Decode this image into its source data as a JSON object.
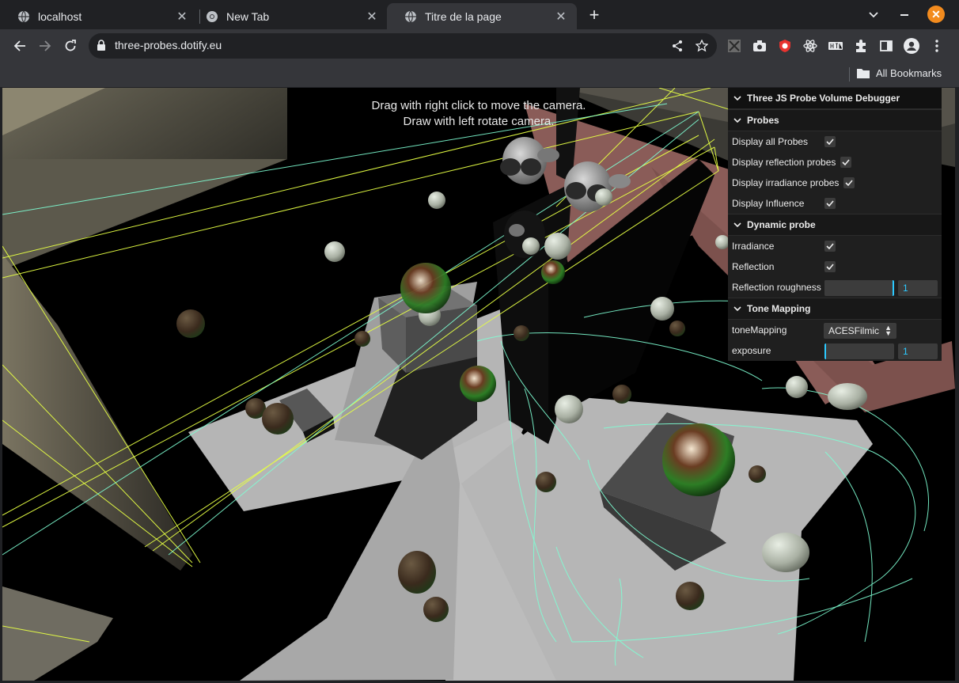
{
  "tabs": [
    {
      "title": "localhost",
      "icon": "globe-icon"
    },
    {
      "title": "New Tab",
      "icon": "chrome-icon"
    },
    {
      "title": "Titre de la page",
      "icon": "globe-icon"
    }
  ],
  "omnibox": {
    "url": "three-probes.dotify.eu"
  },
  "bookmarks": {
    "all_label": "All Bookmarks"
  },
  "scene": {
    "hint_line1": "Drag with right click to move the camera.",
    "hint_line2": "Draw with left rotate camera."
  },
  "gui": {
    "title": "Three JS Probe Volume Debugger",
    "probes": {
      "title": "Probes",
      "display_all": {
        "label": "Display all Probes",
        "checked": true
      },
      "display_reflection": {
        "label": "Display reflection probes",
        "checked": true
      },
      "display_irradiance": {
        "label": "Display irradiance probes",
        "checked": true
      },
      "display_influence": {
        "label": "Display Influence",
        "checked": true
      }
    },
    "dynamic": {
      "title": "Dynamic probe",
      "irradiance": {
        "label": "Irradiance",
        "checked": true
      },
      "reflection": {
        "label": "Reflection",
        "checked": true
      },
      "roughness": {
        "label": "Reflection roughness",
        "value": "1",
        "fraction": 1.0
      }
    },
    "tone": {
      "title": "Tone Mapping",
      "mapping": {
        "label": "toneMapping",
        "value": "ACESFilmic"
      },
      "exposure": {
        "label": "exposure",
        "value": "1",
        "fraction": 0.0
      }
    }
  },
  "colors": {
    "accent": "#2cc9ff",
    "close_button": "#f28b1e",
    "probe_lines": "#7fffd4",
    "bound_lines": "#e0ff40"
  }
}
